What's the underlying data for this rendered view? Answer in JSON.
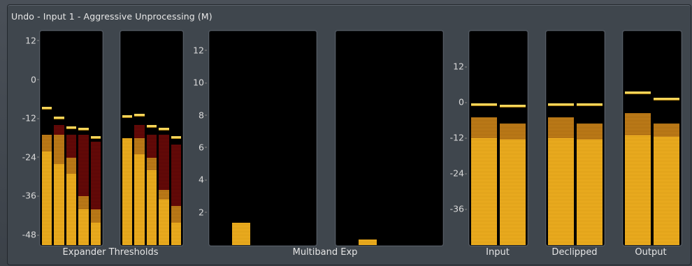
{
  "title": "Undo - Input 1 - Aggressive Unprocessing (M)",
  "colors": {
    "background": "#3f464d",
    "meter_bg": "#000000",
    "level": "#f2b423",
    "gr_orange": "#c5821a",
    "gr_red": "#6a0a08",
    "peak": "#f6d55a"
  },
  "expander": {
    "label": "Expander Thresholds",
    "scale_ticks": [
      "12",
      "0",
      "-12",
      "-24",
      "-36",
      "-48"
    ],
    "scale_values": [
      12,
      0,
      -12,
      -24,
      -36,
      -48
    ],
    "range": [
      -51,
      15
    ]
  },
  "multiband": {
    "label": "Multiband Exp",
    "scale_ticks": [
      "12",
      "10",
      "8",
      "6",
      "4",
      "2"
    ],
    "scale_values": [
      12,
      10,
      8,
      6,
      4,
      2
    ],
    "range": [
      0,
      13.2
    ]
  },
  "io": {
    "scale_ticks": [
      "12",
      "0",
      "-12",
      "-24",
      "-36"
    ],
    "scale_values": [
      12,
      0,
      -12,
      -24,
      -36
    ],
    "range": [
      -48,
      24
    ],
    "labels": {
      "input": "Input",
      "declipped": "Declipped",
      "output": "Output"
    }
  },
  "chart_data": [
    {
      "type": "bar",
      "name": "Expander Thresholds",
      "groups": [
        {
          "bars": [
            {
              "level": -22,
              "orange": -17,
              "red": -17,
              "peak": -9
            },
            {
              "level": -26,
              "orange": -17,
              "red": -14,
              "peak": -12
            },
            {
              "level": -29,
              "orange": -24,
              "red": -17,
              "peak": -15
            },
            {
              "level": -40,
              "orange": -36,
              "red": -17,
              "peak": -15.5
            },
            {
              "level": -44,
              "orange": -40,
              "red": -19,
              "peak": -18
            }
          ]
        },
        {
          "bars": [
            {
              "level": -18,
              "orange": -20,
              "red": -18.5,
              "peak": -11.5
            },
            {
              "level": -23,
              "orange": -18,
              "red": -14,
              "peak": -11
            },
            {
              "level": -28,
              "orange": -24,
              "red": -17,
              "peak": -14.5
            },
            {
              "level": -37,
              "orange": -34,
              "red": -17,
              "peak": -15.5
            },
            {
              "level": -44,
              "orange": -39,
              "red": -20,
              "peak": -18
            }
          ]
        }
      ]
    },
    {
      "type": "bar",
      "name": "Multiband Exp",
      "values": [
        1.4,
        0.35
      ],
      "range": [
        0,
        13.2
      ]
    },
    {
      "type": "bar",
      "name": "Input / Declipped / Output",
      "groups": [
        {
          "label": "Input",
          "bars": [
            {
              "level": -12,
              "orange": -5,
              "peak": -1
            },
            {
              "level": -12.5,
              "orange": -7,
              "peak": -1.5
            }
          ]
        },
        {
          "label": "Declipped",
          "bars": [
            {
              "level": -12,
              "orange": -5,
              "peak": -1
            },
            {
              "level": -12.5,
              "orange": -7,
              "peak": -1
            }
          ]
        },
        {
          "label": "Output",
          "bars": [
            {
              "level": -11,
              "orange": -3.5,
              "peak": 3
            },
            {
              "level": -11.5,
              "orange": -7,
              "peak": 1
            }
          ]
        }
      ]
    }
  ]
}
